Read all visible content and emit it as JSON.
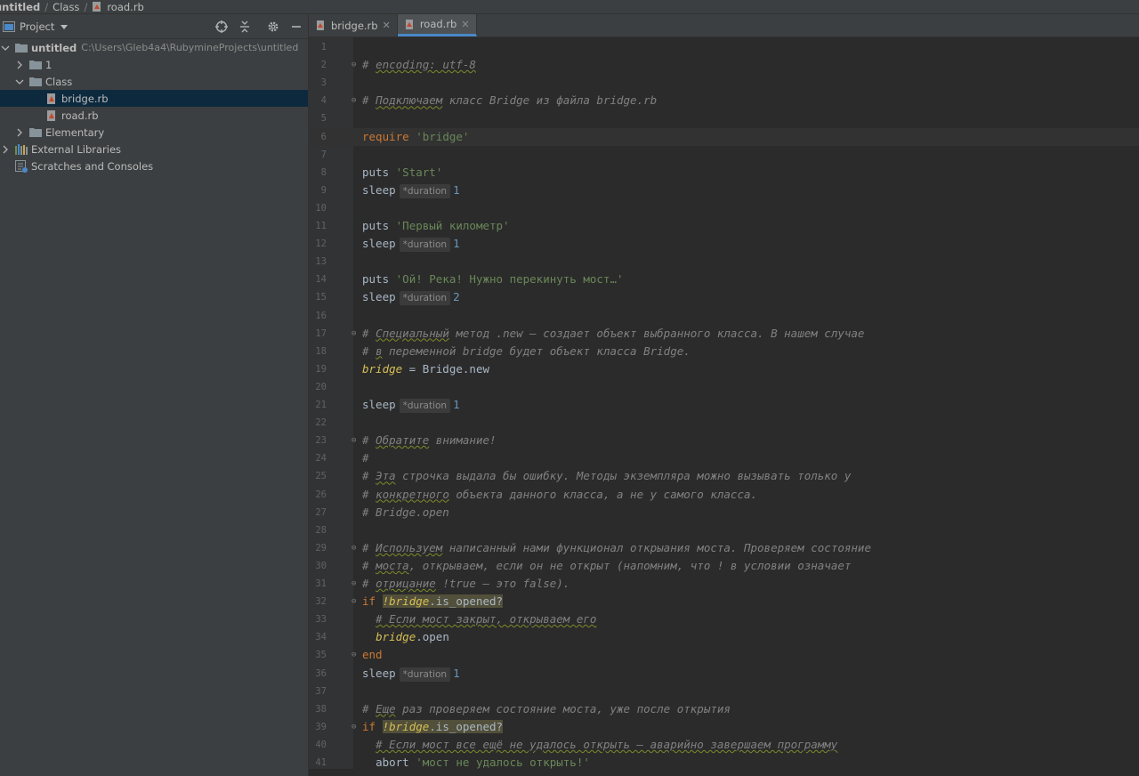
{
  "breadcrumb": [
    "untitled",
    "Class",
    "road.rb"
  ],
  "project": {
    "title": "Project",
    "tree": [
      {
        "label": "untitled",
        "path": "C:\\Users\\Gleb4a4\\RubymineProjects\\untitled",
        "depth": 0,
        "type": "folder",
        "expanded": true
      },
      {
        "label": "1",
        "depth": 1,
        "type": "folder",
        "expanded": false
      },
      {
        "label": "Class",
        "depth": 1,
        "type": "folder",
        "expanded": true
      },
      {
        "label": "bridge.rb",
        "depth": 2,
        "type": "ruby-file",
        "selected": true
      },
      {
        "label": "road.rb",
        "depth": 2,
        "type": "ruby-file"
      },
      {
        "label": "Elementary",
        "depth": 1,
        "type": "folder",
        "expanded": false
      },
      {
        "label": "External Libraries",
        "depth": 0,
        "type": "libraries",
        "expanded": false
      },
      {
        "label": "Scratches and Consoles",
        "depth": 0,
        "type": "scratches"
      }
    ]
  },
  "tabs": [
    {
      "label": "bridge.rb",
      "active": false
    },
    {
      "label": "road.rb",
      "active": true
    }
  ],
  "editor": {
    "caret_line": 6,
    "lines": [
      {
        "n": "1",
        "tokens": []
      },
      {
        "n": "2",
        "fold": true,
        "tokens": [
          {
            "t": "# ",
            "c": "cm"
          },
          {
            "t": "encoding: utf-8",
            "c": "cm ul"
          }
        ]
      },
      {
        "n": "3",
        "tokens": []
      },
      {
        "n": "4",
        "fold": true,
        "tokens": [
          {
            "t": "# ",
            "c": "cm"
          },
          {
            "t": "Подключаем",
            "c": "cm ul"
          },
          {
            "t": " класс Bridge из файла bridge.rb",
            "c": "cm"
          }
        ]
      },
      {
        "n": "5",
        "tokens": []
      },
      {
        "n": "6",
        "tokens": [
          {
            "t": "require",
            "c": "kw"
          },
          {
            "t": " ",
            "c": "plain"
          },
          {
            "t": "'bridge'",
            "c": "str"
          }
        ]
      },
      {
        "n": "7",
        "tokens": []
      },
      {
        "n": "8",
        "tokens": [
          {
            "t": "puts ",
            "c": "plain"
          },
          {
            "t": "'Start'",
            "c": "str"
          }
        ]
      },
      {
        "n": "9",
        "tokens": [
          {
            "t": "sleep",
            "c": "plain"
          },
          {
            "t": "*duration",
            "c": "hint"
          },
          {
            "t": "1",
            "c": "num"
          }
        ]
      },
      {
        "n": "10",
        "tokens": []
      },
      {
        "n": "11",
        "tokens": [
          {
            "t": "puts ",
            "c": "plain"
          },
          {
            "t": "'Первый километр'",
            "c": "str"
          }
        ]
      },
      {
        "n": "12",
        "tokens": [
          {
            "t": "sleep",
            "c": "plain"
          },
          {
            "t": "*duration",
            "c": "hint"
          },
          {
            "t": "1",
            "c": "num"
          }
        ]
      },
      {
        "n": "13",
        "tokens": []
      },
      {
        "n": "14",
        "tokens": [
          {
            "t": "puts ",
            "c": "plain"
          },
          {
            "t": "'Ой! Река! Нужно перекинуть мост…'",
            "c": "str"
          }
        ]
      },
      {
        "n": "15",
        "tokens": [
          {
            "t": "sleep",
            "c": "plain"
          },
          {
            "t": "*duration",
            "c": "hint"
          },
          {
            "t": "2",
            "c": "num"
          }
        ]
      },
      {
        "n": "16",
        "tokens": []
      },
      {
        "n": "17",
        "fold": true,
        "tokens": [
          {
            "t": "# ",
            "c": "cm"
          },
          {
            "t": "Специальный",
            "c": "cm ul"
          },
          {
            "t": " метод .new — создает объект выбранного класса. В нашем случае",
            "c": "cm"
          }
        ]
      },
      {
        "n": "18",
        "tokens": [
          {
            "t": "# ",
            "c": "cm"
          },
          {
            "t": "в",
            "c": "cm ul"
          },
          {
            "t": " переменной bridge будет объект класса Bridge.",
            "c": "cm"
          }
        ]
      },
      {
        "n": "19",
        "tokens": [
          {
            "t": "bridge",
            "c": "var"
          },
          {
            "t": " = ",
            "c": "plain"
          },
          {
            "t": "Bridge",
            "c": "plain"
          },
          {
            "t": ".new",
            "c": "meth"
          }
        ]
      },
      {
        "n": "20",
        "tokens": []
      },
      {
        "n": "21",
        "tokens": [
          {
            "t": "sleep",
            "c": "plain"
          },
          {
            "t": "*duration",
            "c": "hint"
          },
          {
            "t": "1",
            "c": "num"
          }
        ]
      },
      {
        "n": "22",
        "tokens": []
      },
      {
        "n": "23",
        "fold": true,
        "tokens": [
          {
            "t": "# ",
            "c": "cm"
          },
          {
            "t": "Обратите",
            "c": "cm ul"
          },
          {
            "t": " внимание!",
            "c": "cm"
          }
        ]
      },
      {
        "n": "24",
        "tokens": [
          {
            "t": "#",
            "c": "cm"
          }
        ]
      },
      {
        "n": "25",
        "tokens": [
          {
            "t": "# ",
            "c": "cm"
          },
          {
            "t": "Эта",
            "c": "cm ul"
          },
          {
            "t": " строчка выдала бы ошибку. Методы экземпляра можно вызывать только у",
            "c": "cm"
          }
        ]
      },
      {
        "n": "26",
        "tokens": [
          {
            "t": "# ",
            "c": "cm"
          },
          {
            "t": "конкретного",
            "c": "cm ul"
          },
          {
            "t": " объекта данного класса, а не у самого класса.",
            "c": "cm"
          }
        ]
      },
      {
        "n": "27",
        "tokens": [
          {
            "t": "# Bridge.open",
            "c": "cm"
          }
        ]
      },
      {
        "n": "28",
        "tokens": []
      },
      {
        "n": "29",
        "fold": true,
        "tokens": [
          {
            "t": "# ",
            "c": "cm"
          },
          {
            "t": "Используем",
            "c": "cm ul"
          },
          {
            "t": " написанный нами функционал открыания моста. Проверяем состояние",
            "c": "cm"
          }
        ]
      },
      {
        "n": "30",
        "tokens": [
          {
            "t": "# ",
            "c": "cm"
          },
          {
            "t": "моста",
            "c": "cm ul"
          },
          {
            "t": ", открываем, если он не открыт (напомним, что ! в условии означает",
            "c": "cm"
          }
        ]
      },
      {
        "n": "31",
        "fold": true,
        "tokens": [
          {
            "t": "# ",
            "c": "cm"
          },
          {
            "t": "отрицание",
            "c": "cm ul"
          },
          {
            "t": " !true — это false).",
            "c": "cm"
          }
        ]
      },
      {
        "n": "32",
        "fold": true,
        "tokens": [
          {
            "t": "if",
            "c": "kw"
          },
          {
            "t": " ",
            "c": "plain"
          },
          {
            "t": "!bridge",
            "c": "var warn"
          },
          {
            "t": ".is_opened?",
            "c": "meth warn"
          }
        ]
      },
      {
        "n": "33",
        "tokens": [
          {
            "t": "  ",
            "c": "plain"
          },
          {
            "t": "# Если мост закрыт, открываем его",
            "c": "cm ul"
          }
        ]
      },
      {
        "n": "34",
        "tokens": [
          {
            "t": "  ",
            "c": "plain"
          },
          {
            "t": "bridge",
            "c": "var"
          },
          {
            "t": ".open",
            "c": "meth"
          }
        ]
      },
      {
        "n": "35",
        "fold": true,
        "tokens": [
          {
            "t": "end",
            "c": "kw"
          }
        ]
      },
      {
        "n": "36",
        "tokens": [
          {
            "t": "sleep",
            "c": "plain"
          },
          {
            "t": "*duration",
            "c": "hint"
          },
          {
            "t": "1",
            "c": "num"
          }
        ]
      },
      {
        "n": "37",
        "tokens": []
      },
      {
        "n": "38",
        "tokens": [
          {
            "t": "# ",
            "c": "cm"
          },
          {
            "t": "Еще",
            "c": "cm ul"
          },
          {
            "t": " раз проверяем состояние моста, уже после открытия",
            "c": "cm"
          }
        ]
      },
      {
        "n": "39",
        "fold": true,
        "tokens": [
          {
            "t": "if",
            "c": "kw"
          },
          {
            "t": " ",
            "c": "plain"
          },
          {
            "t": "!bridge",
            "c": "var warn"
          },
          {
            "t": ".is_opened?",
            "c": "meth warn"
          }
        ]
      },
      {
        "n": "40",
        "tokens": [
          {
            "t": "  ",
            "c": "plain"
          },
          {
            "t": "# Если мост все ещё не удалось открыть — аварийно завершаем программу",
            "c": "cm ul"
          }
        ]
      },
      {
        "n": "41",
        "tokens": [
          {
            "t": "  ",
            "c": "plain"
          },
          {
            "t": "abort ",
            "c": "plain"
          },
          {
            "t": "'мост не удалось открыть!'",
            "c": "str"
          }
        ]
      }
    ]
  },
  "colors": {
    "selection": "#0d293e",
    "tab_accent": "#4a88c7",
    "keyword": "#cc7832",
    "string": "#6a8759",
    "number": "#6897bb"
  }
}
